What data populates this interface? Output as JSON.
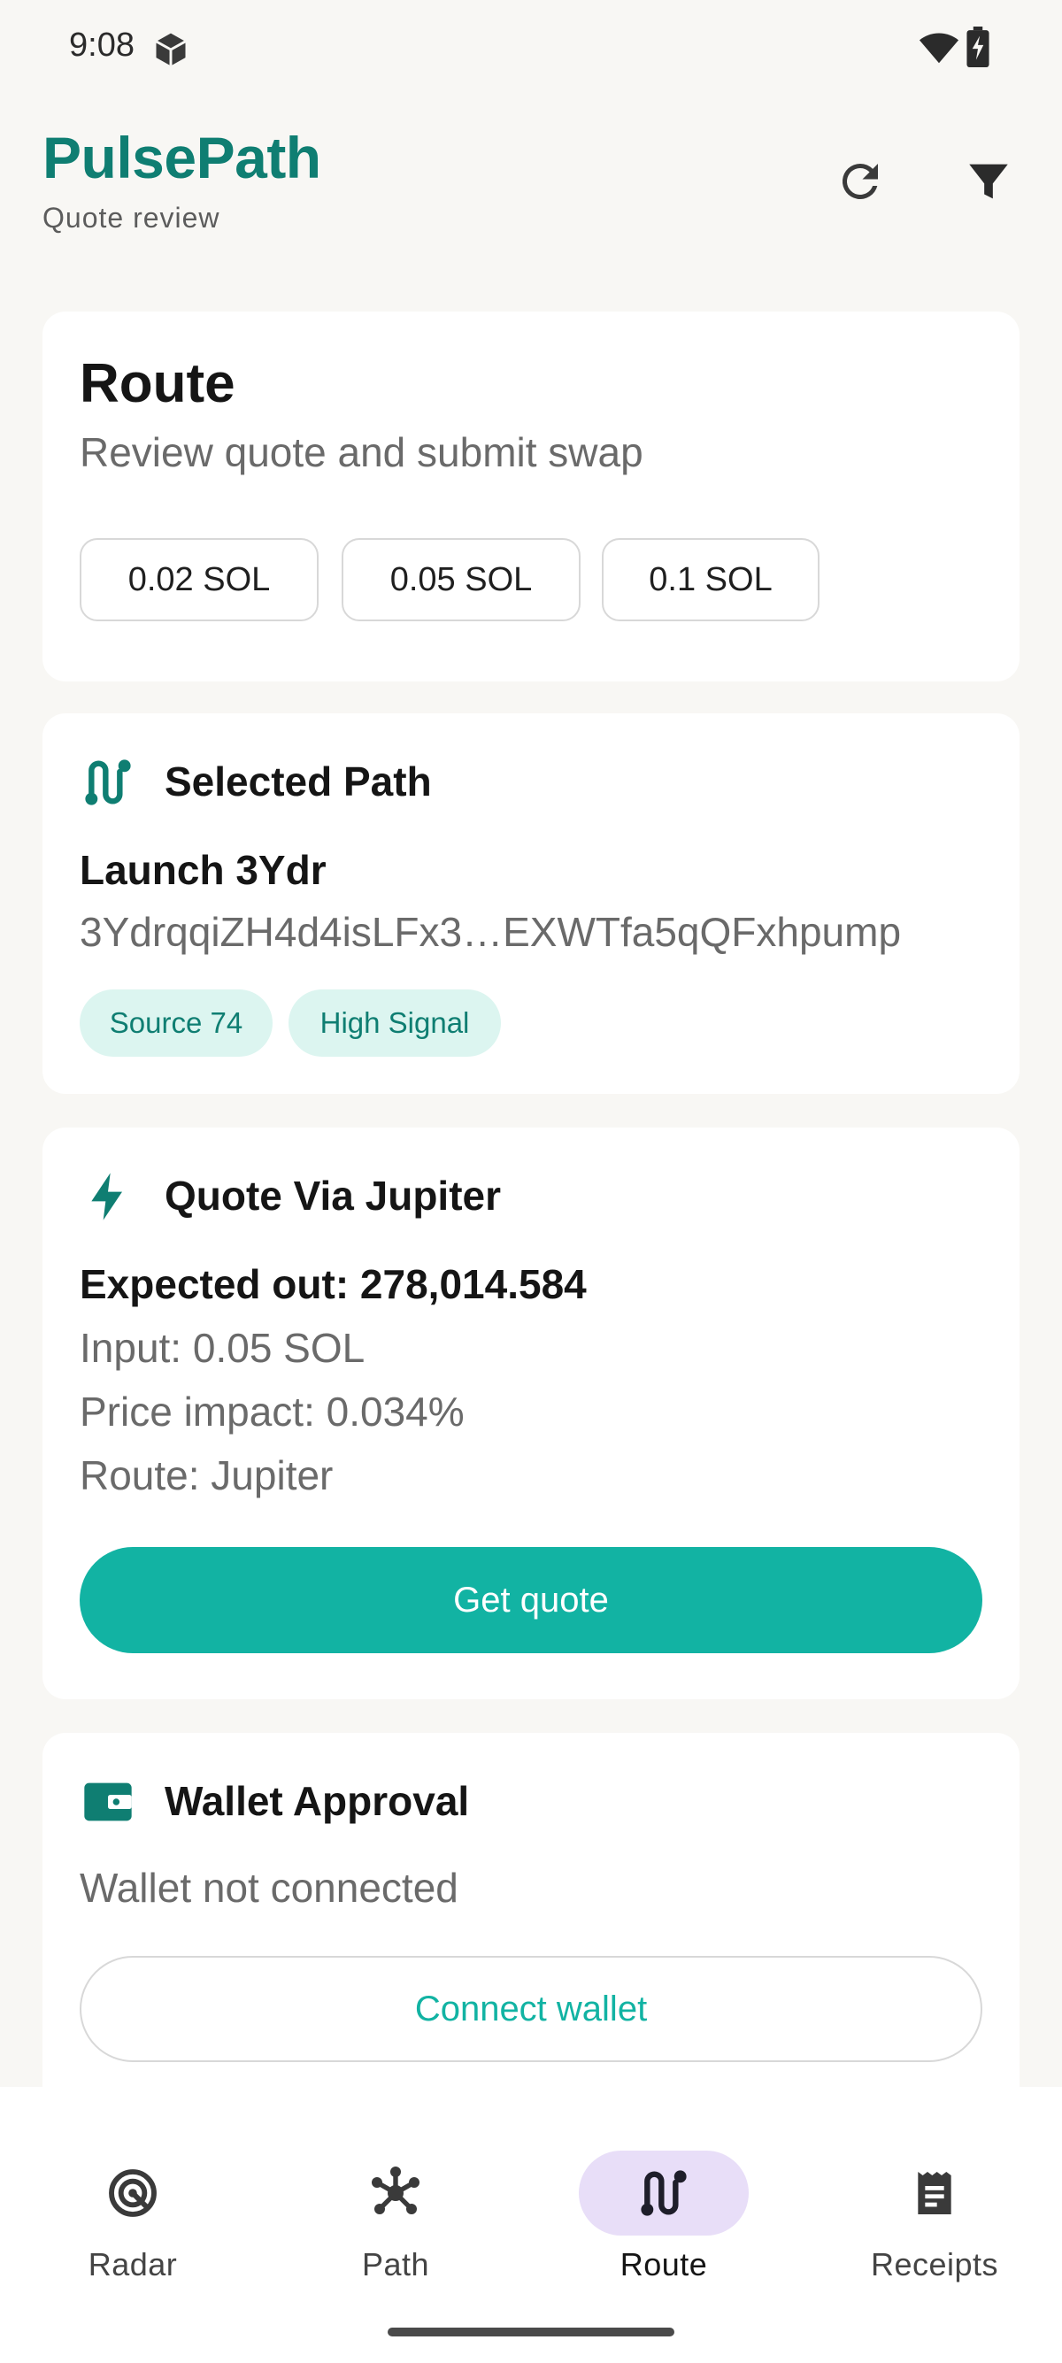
{
  "status_bar": {
    "time": "9:08"
  },
  "header": {
    "title": "PulsePath",
    "subtitle": "Quote review",
    "actions": {
      "refresh_icon": "refresh-icon",
      "filter_icon": "filter-icon"
    }
  },
  "route_card": {
    "title": "Route",
    "subtitle": "Review quote and submit swap",
    "amount_chips": [
      "0.02 SOL",
      "0.05 SOL",
      "0.1 SOL"
    ]
  },
  "path_card": {
    "title": "Selected Path",
    "name": "Launch 3Ydr",
    "address": "3YdrqqiZH4d4isLFx3…EXWTfa5qQFxhpump",
    "tags": [
      "Source 74",
      "High Signal"
    ]
  },
  "quote_card": {
    "title": "Quote Via Jupiter",
    "expected_out": "Expected out: 278,014.584",
    "input": "Input: 0.05 SOL",
    "price_impact": "Price impact: 0.034%",
    "route": "Route: Jupiter",
    "button_label": "Get quote"
  },
  "wallet_card": {
    "title": "Wallet Approval",
    "status": "Wallet not connected",
    "button_label": "Connect wallet"
  },
  "bottom_nav": {
    "items": [
      {
        "label": "Radar",
        "icon": "radar-icon"
      },
      {
        "label": "Path",
        "icon": "network-icon"
      },
      {
        "label": "Route",
        "icon": "route-icon",
        "active": true
      },
      {
        "label": "Receipts",
        "icon": "receipt-icon"
      }
    ]
  },
  "colors": {
    "brand": "#0f7e72",
    "accent": "#12b3a3",
    "tag_bg": "#dcf5f0",
    "nav_active_bg": "#e8def8",
    "background": "#f8f7f4"
  }
}
